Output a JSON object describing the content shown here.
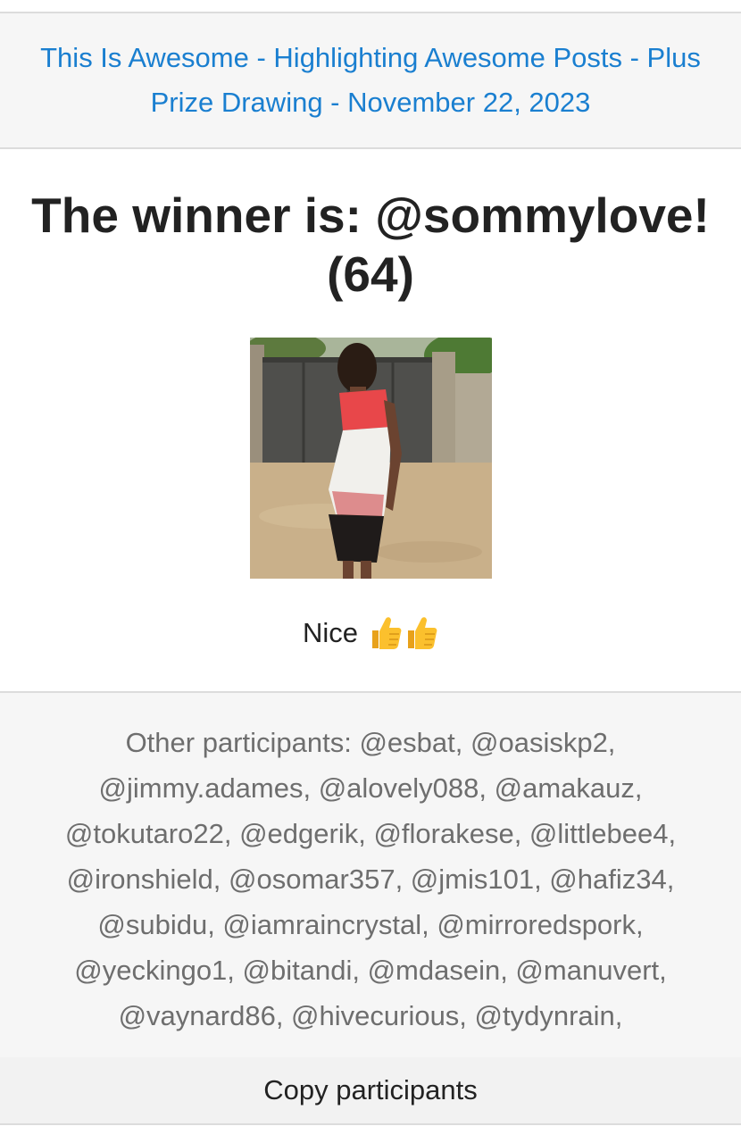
{
  "header": {
    "post_link_text": "This Is Awesome - Highlighting Awesome Posts - Plus Prize Drawing - November 22, 2023"
  },
  "winner": {
    "title": "The winner is: @sommylove! (64)"
  },
  "comment": {
    "text": "Nice",
    "emoji": [
      "thumbs-up-icon",
      "thumbs-up-icon"
    ]
  },
  "participants": {
    "text": "Other participants: @esbat, @oasiskp2, @jimmy.adames, @alovely088, @amakauz, @tokutaro22, @edgerik, @florakese, @littlebee4, @ironshield, @osomar357, @jmis101, @hafiz34, @subidu, @iamraincrystal, @mirroredspork, @yeckingo1, @bitandi, @mdasein, @manuvert, @vaynard86, @hivecurious, @tydynrain,"
  },
  "actions": {
    "copy_label": "Copy participants"
  },
  "colors": {
    "link": "#1a7fd0",
    "title_text": "#222222",
    "muted_text": "#6e6e6e",
    "card_background": "#f6f6f6",
    "divider": "#dcdcdc"
  }
}
